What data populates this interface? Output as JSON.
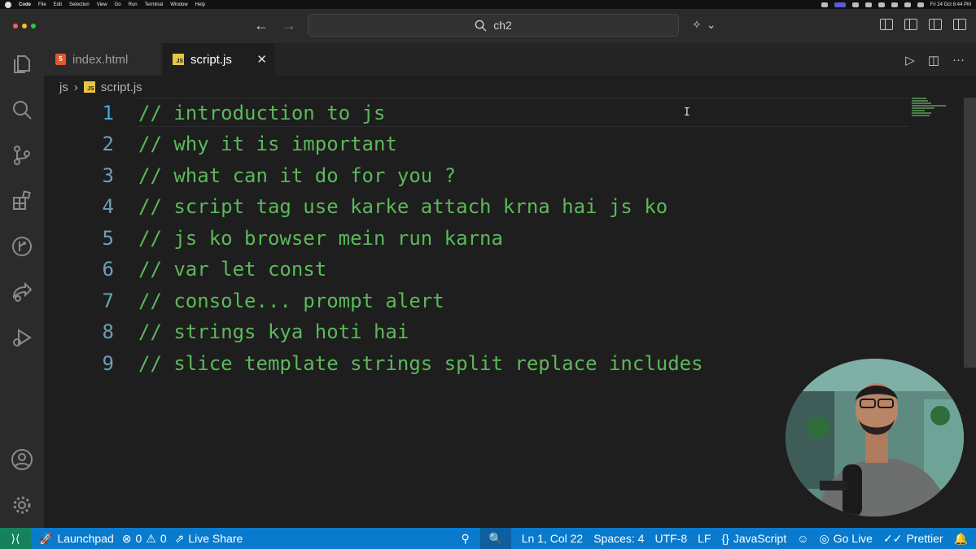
{
  "menubar": {
    "app": "Code",
    "items": [
      "File",
      "Edit",
      "Selection",
      "View",
      "Go",
      "Run",
      "Terminal",
      "Window",
      "Help"
    ],
    "clock": "Fri 24 Oct  8:44 PM"
  },
  "titlebar": {
    "search_text": "ch2",
    "traffic_colors": [
      "#ff5f57",
      "#febc2e",
      "#28c840"
    ]
  },
  "activity_bar": {
    "icons": [
      "files-icon",
      "search-icon",
      "source-control-icon",
      "extensions-icon",
      "git-graph-icon",
      "live-share-icon",
      "run-debug-icon",
      "account-icon",
      "settings-gear-icon"
    ]
  },
  "tabs": [
    {
      "label": "index.html",
      "icon": "html-file-icon",
      "active": false
    },
    {
      "label": "script.js",
      "icon": "js-file-icon",
      "active": true
    }
  ],
  "breadcrumb": {
    "folder": "js",
    "file": "script.js"
  },
  "code_lines": [
    {
      "num": "1",
      "text": "// introduction to js"
    },
    {
      "num": "2",
      "text": "// why it is important"
    },
    {
      "num": "3",
      "text": "// what can it do for you ?"
    },
    {
      "num": "4",
      "text": "// script tag use karke attach krna hai js ko"
    },
    {
      "num": "5",
      "text": "// js ko browser mein run karna"
    },
    {
      "num": "6",
      "text": "// var let const"
    },
    {
      "num": "7",
      "text": "// console... prompt alert"
    },
    {
      "num": "8",
      "text": "// strings kya hoti hai"
    },
    {
      "num": "9",
      "text": "// slice template strings split replace includes"
    }
  ],
  "status_bar": {
    "launchpad": "Launchpad",
    "errors": "0",
    "warnings": "0",
    "live_share": "Live Share",
    "cursor_pos": "Ln 1, Col 22",
    "spaces": "Spaces: 4",
    "encoding": "UTF-8",
    "eol": "LF",
    "language": "JavaScript",
    "go_live": "Go Live",
    "prettier": "Prettier"
  },
  "colors": {
    "comment": "#5cb85a",
    "line_number": "#6e9fb8",
    "status_bar": "#0a7acc",
    "remote": "#16825d"
  }
}
